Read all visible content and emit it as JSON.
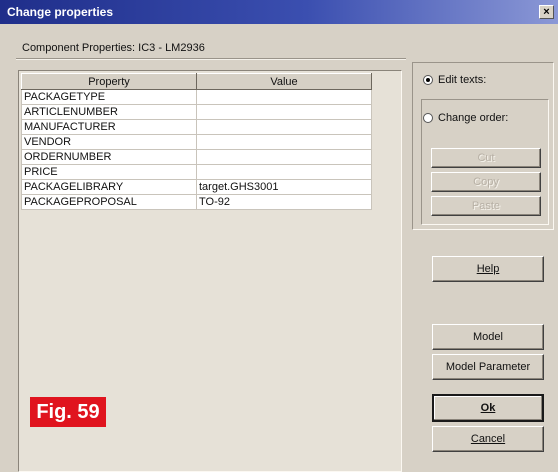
{
  "window": {
    "title": "Change properties",
    "close_glyph": "×"
  },
  "subtitle": "Component Properties: IC3 - LM2936",
  "grid": {
    "headers": [
      "Property",
      "Value"
    ],
    "rows": [
      {
        "property": "PACKAGETYPE",
        "value": ""
      },
      {
        "property": "ARTICLENUMBER",
        "value": ""
      },
      {
        "property": "MANUFACTURER",
        "value": ""
      },
      {
        "property": "VENDOR",
        "value": ""
      },
      {
        "property": "ORDERNUMBER",
        "value": ""
      },
      {
        "property": "PRICE",
        "value": ""
      },
      {
        "property": "PACKAGELIBRARY",
        "value": "target.GHS3001"
      },
      {
        "property": "PACKAGEPROPOSAL",
        "value": "TO-92"
      }
    ]
  },
  "mode": {
    "edit_texts": {
      "label": "Edit texts:",
      "checked": true
    },
    "change_order": {
      "label": "Change order:",
      "checked": false
    }
  },
  "buttons": {
    "cut": "Cut",
    "copy": "Copy",
    "paste": "Paste",
    "help": "Help",
    "model": "Model",
    "model_parameter": "Model Parameter",
    "ok": "Ok",
    "cancel": "Cancel"
  },
  "figure_label": "Fig. 59",
  "colors": {
    "figure_badge": "#e0141e",
    "titlebar": "#1f2e8a"
  }
}
